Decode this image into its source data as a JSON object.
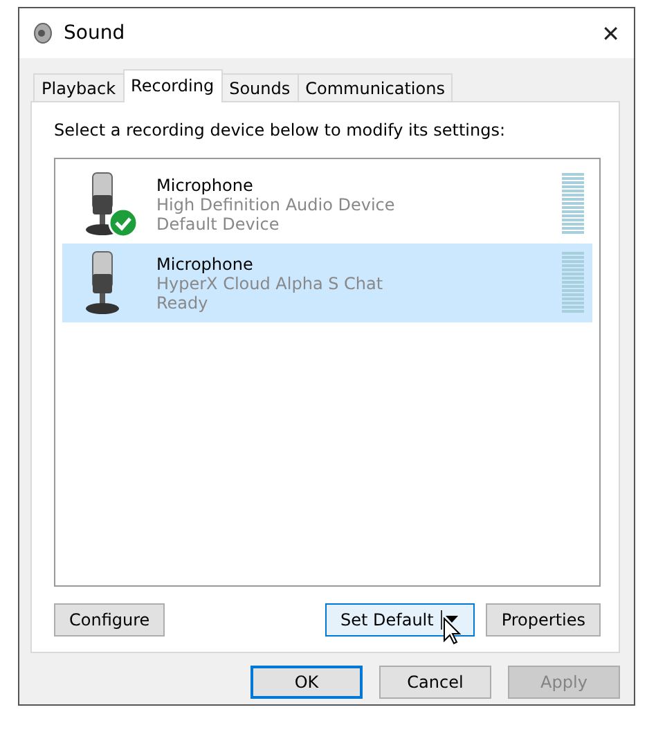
{
  "window": {
    "title": "Sound",
    "close": "✕"
  },
  "tabs": [
    {
      "label": "Playback",
      "selected": false
    },
    {
      "label": "Recording",
      "selected": true
    },
    {
      "label": "Sounds",
      "selected": false
    },
    {
      "label": "Communications",
      "selected": false
    }
  ],
  "instruction": "Select a recording device below to modify its settings:",
  "devices": [
    {
      "name": "Microphone",
      "description": "High Definition Audio Device",
      "status": "Default Device",
      "default": true,
      "selected": false
    },
    {
      "name": "Microphone",
      "description": "HyperX Cloud Alpha S Chat",
      "status": "Ready",
      "default": false,
      "selected": true
    }
  ],
  "panel_buttons": [
    {
      "label": "Configure",
      "kind": "plain",
      "focused": false
    },
    {
      "label": "Set Default",
      "kind": "split",
      "focused": true
    },
    {
      "label": "Properties",
      "kind": "plain",
      "focused": false
    }
  ],
  "dialog_buttons": [
    {
      "label": "OK",
      "default": true,
      "disabled": false
    },
    {
      "label": "Cancel",
      "default": false,
      "disabled": false
    },
    {
      "label": "Apply",
      "default": false,
      "disabled": true
    }
  ]
}
